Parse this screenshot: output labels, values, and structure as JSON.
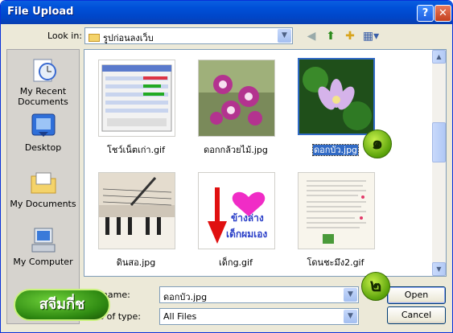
{
  "window": {
    "title": "File Upload",
    "help_glyph": "?",
    "close_glyph": "✕"
  },
  "lookin": {
    "label": "Look in:",
    "value": "รูปก่อนลงเว็บ"
  },
  "places": [
    {
      "label": "My Recent Documents",
      "icon": "recent-documents-icon"
    },
    {
      "label": "Desktop",
      "icon": "desktop-icon"
    },
    {
      "label": "My Documents",
      "icon": "my-documents-icon"
    },
    {
      "label": "My Computer",
      "icon": "my-computer-icon"
    }
  ],
  "files": [
    {
      "name": "โชว์เน็ตเก่า.gif",
      "selected": false
    },
    {
      "name": "ดอกกล้วยไม้.jpg",
      "selected": false
    },
    {
      "name": "ดอกบัว.jpg",
      "selected": true
    },
    {
      "name": "ดินสอ.jpg",
      "selected": false
    },
    {
      "name": "เด็กg.gif",
      "selected": false
    },
    {
      "name": "โดนชะมึง2.gif",
      "selected": false
    }
  ],
  "thumb_text": {
    "line1": "ข้างล่าง",
    "line2": "เด็กผมเอง"
  },
  "filename": {
    "label": "File name:",
    "value": "ดอกบัว.jpg"
  },
  "filetype": {
    "label": "Files of type:",
    "value": "All Files"
  },
  "buttons": {
    "open": "Open",
    "cancel": "Cancel"
  },
  "badges": {
    "one": "๑",
    "two": "๒"
  },
  "stamp": "สจีมกี่ช"
}
